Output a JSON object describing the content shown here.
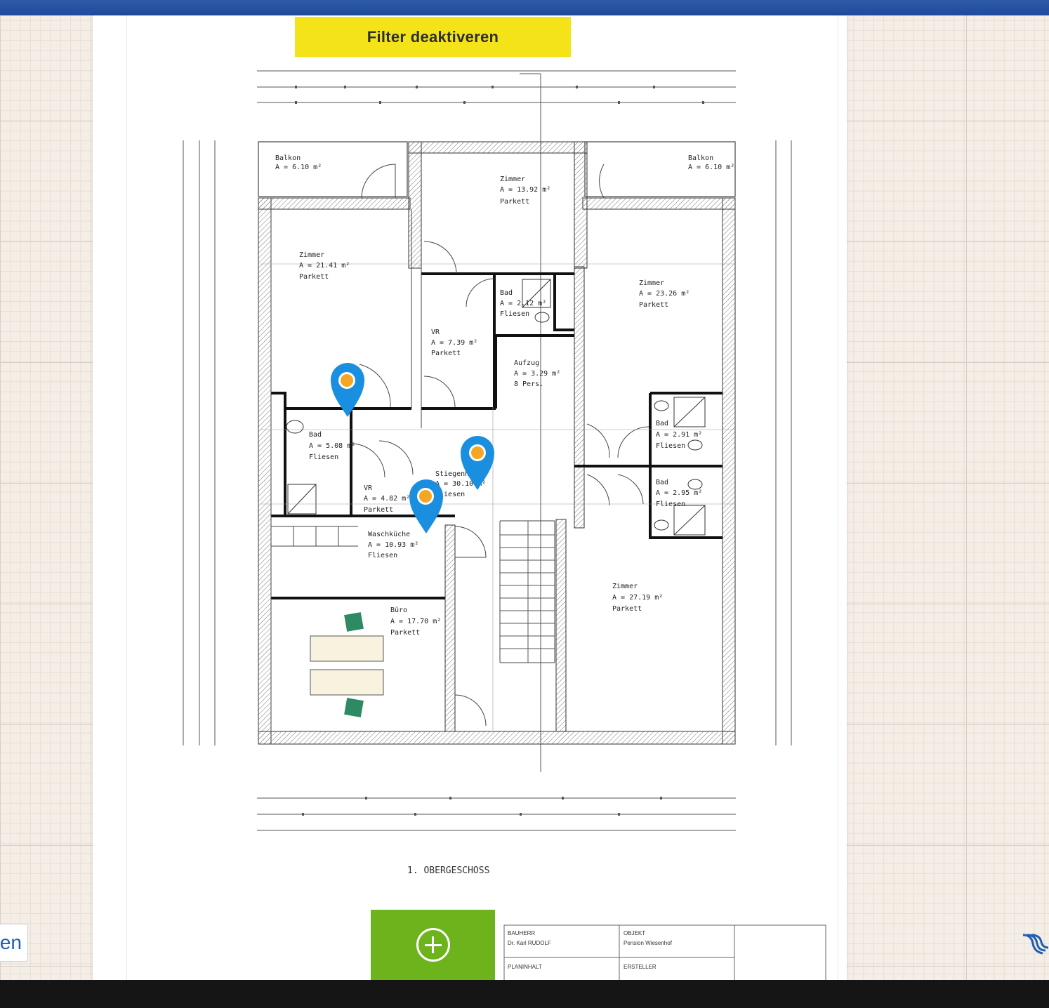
{
  "toolbar": {
    "filter_button_label": "Filter deaktiveren"
  },
  "plan": {
    "floor_title": "1. OBERGESCHOSS",
    "rooms": [
      {
        "name": "Balkon",
        "area": "A = 6.10 m²"
      },
      {
        "name": "Zimmer",
        "area": "A = 13.92 m²",
        "floor": "Parkett"
      },
      {
        "name": "Balkon",
        "area": "A = 6.10 m²"
      },
      {
        "name": "Zimmer",
        "area": "A = 21.41 m²",
        "floor": "Parkett"
      },
      {
        "name": "Bad",
        "area": "A = 2.12 m²",
        "floor": "Fliesen"
      },
      {
        "name": "VR",
        "area": "A = 7.39 m²",
        "floor": "Parkett"
      },
      {
        "name": "Aufzug",
        "area": "A = 3.29 m²",
        "floor": "8 Pers."
      },
      {
        "name": "Zimmer",
        "area": "A = 23.26 m²",
        "floor": "Parkett"
      },
      {
        "name": "Bad",
        "area": "A = 5.08 m²",
        "floor": "Fliesen"
      },
      {
        "name": "VR",
        "area": "A = 4.82 m²",
        "floor": "Parkett"
      },
      {
        "name": "Stiegenhaus",
        "area": "A = 30.10 m²",
        "floor": "Fliesen"
      },
      {
        "name": "Bad",
        "area": "A = 2.91 m²",
        "floor": "Fliesen"
      },
      {
        "name": "Bad",
        "area": "A = 2.95 m²",
        "floor": "Fliesen"
      },
      {
        "name": "Waschküche",
        "area": "A = 10.93 m²",
        "floor": "Fliesen"
      },
      {
        "name": "Büro",
        "area": "A = 17.70 m²",
        "floor": "Parkett"
      },
      {
        "name": "Zimmer",
        "area": "A = 27.19 m²",
        "floor": "Parkett"
      }
    ],
    "title_block": {
      "bauherr_label": "BAUHERR",
      "bauherr_value": "Dr. Karl RUDOLF",
      "objekt_label": "OBJEKT",
      "objekt_value": "Pension Wiesenhof",
      "planinhalt_label": "PLANINHALT",
      "ersteller_label": "ERSTELLER"
    },
    "markers": [
      {
        "name": "marker-1",
        "color": "#1a8fe0",
        "dot": "#f5a623"
      },
      {
        "name": "marker-2",
        "color": "#1a8fe0",
        "dot": "#f5a623"
      },
      {
        "name": "marker-3",
        "color": "#1a8fe0",
        "dot": "#f5a623"
      }
    ]
  },
  "sidebar": {
    "left_button_label": "en"
  },
  "colors": {
    "accent_yellow": "#f5e31a",
    "accent_green": "#6cb31c",
    "topbar_blue": "#1e4b9c"
  }
}
